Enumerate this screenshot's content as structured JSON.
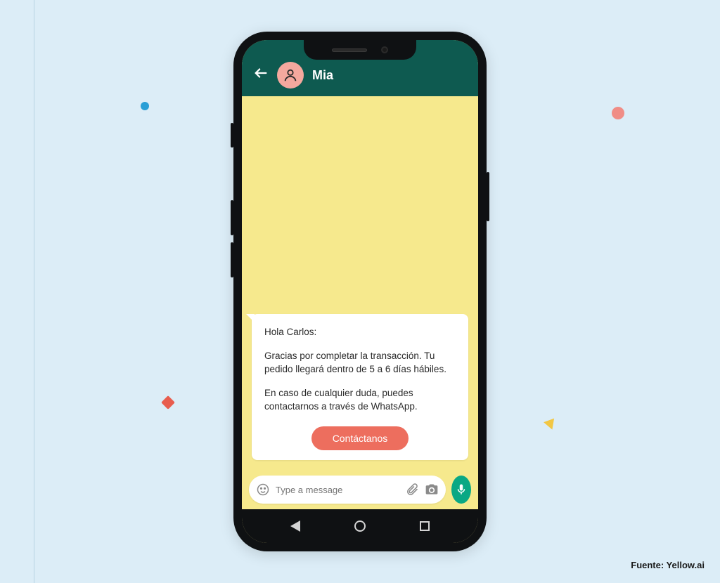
{
  "header": {
    "contact_name": "Mia"
  },
  "message": {
    "greeting": "Hola Carlos:",
    "body1": "Gracias por completar la transacción. Tu pedido llegará dentro de 5 a 6 días hábiles.",
    "body2": "En caso de cualquier duda, puedes contactarnos a través de WhatsApp.",
    "button_label": "Contáctanos"
  },
  "input": {
    "placeholder": "Type a message"
  },
  "footer": {
    "source": "Fuente: Yellow.ai"
  },
  "colors": {
    "bg": "#dcedf7",
    "header": "#0e5a50",
    "chat_bg": "#f6e98d",
    "button": "#ed6e5e",
    "mic": "#0aa884"
  }
}
